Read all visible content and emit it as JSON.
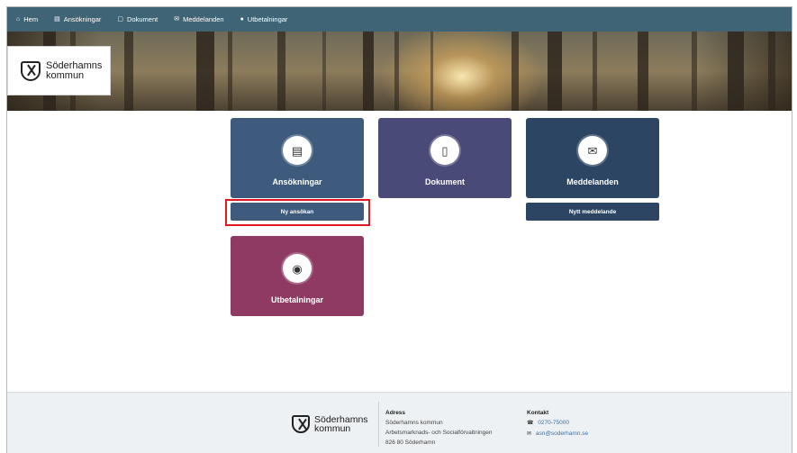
{
  "nav": {
    "items": [
      {
        "icon": "home-icon",
        "glyph": "⌂",
        "label": "Hem"
      },
      {
        "icon": "file-icon",
        "glyph": "▤",
        "label": "Ansökningar"
      },
      {
        "icon": "document-icon",
        "glyph": "▢",
        "label": "Dokument"
      },
      {
        "icon": "envelope-icon",
        "glyph": "✉",
        "label": "Meddelanden"
      },
      {
        "icon": "coins-icon",
        "glyph": "●",
        "label": "Utbetalningar"
      }
    ]
  },
  "brand": {
    "line1": "Söderhamns",
    "line2": "kommun"
  },
  "tiles": {
    "applications": {
      "label": "Ansökningar",
      "icon": "clipboard-icon",
      "glyph": "▤",
      "color": "#3e5b7e",
      "action": "Ny ansökan"
    },
    "documents": {
      "label": "Dokument",
      "icon": "document-icon",
      "glyph": "▯",
      "color": "#4a4a79"
    },
    "messages": {
      "label": "Meddelanden",
      "icon": "envelope-icon",
      "glyph": "✉",
      "color": "#2c4563",
      "action": "Nytt meddelande"
    },
    "payments": {
      "label": "Utbetalningar",
      "icon": "money-icon",
      "glyph": "◉",
      "color": "#8e3a63"
    }
  },
  "footer": {
    "address": {
      "heading": "Adress",
      "lines": [
        "Söderhamns kommun",
        "Arbetsmarknads- och Socialförvaltningen",
        "826 80 Söderhamn"
      ]
    },
    "contact": {
      "heading": "Kontakt",
      "phone_icon": "phone-icon",
      "phone": "0270-75000",
      "email_icon": "envelope-icon",
      "email": "asn@soderhamn.se"
    }
  },
  "colors": {
    "nav": "#3f6476",
    "highlight": "#e0181f",
    "footer_bg": "#eef1f3"
  }
}
